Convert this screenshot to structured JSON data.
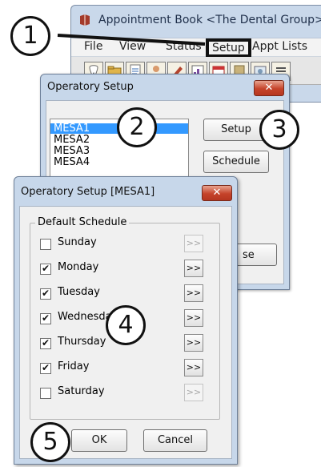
{
  "main_window": {
    "title": "Appointment Book <The Dental Group>",
    "menu": [
      "File",
      "View",
      "Status",
      "Setup",
      "Appt Lists"
    ],
    "toolbar_icons": [
      "tooth-icon",
      "folder-icon",
      "note-icon",
      "person-icon",
      "pencil-icon",
      "chart-icon",
      "calendar-icon",
      "book-icon",
      "photo-icon",
      "list-icon"
    ]
  },
  "operatory_setup": {
    "title": "Operatory Setup",
    "close_glyph": "✕",
    "operatories": [
      "MESA1",
      "MESA2",
      "MESA3",
      "MESA4"
    ],
    "setup_button": "Setup",
    "schedule_button": "Schedule",
    "close_partial_label": "se"
  },
  "mesa_dialog": {
    "title": "Operatory Setup [MESA1]",
    "close_glyph": "✕",
    "group_label": "Default Schedule",
    "days": [
      {
        "label": "Sunday",
        "checked": false,
        "enabled": false
      },
      {
        "label": "Monday",
        "checked": true,
        "enabled": true
      },
      {
        "label": "Tuesday",
        "checked": true,
        "enabled": true
      },
      {
        "label": "Wednesday",
        "checked": true,
        "enabled": true
      },
      {
        "label": "Thursday",
        "checked": true,
        "enabled": true
      },
      {
        "label": "Friday",
        "checked": true,
        "enabled": true
      },
      {
        "label": "Saturday",
        "checked": false,
        "enabled": false
      }
    ],
    "arrow_label": ">>",
    "ok_button": "OK",
    "cancel_button": "Cancel"
  },
  "callouts": [
    "1",
    "2",
    "3",
    "4",
    "5"
  ],
  "colors": {
    "selection": "#3399ff",
    "title_bar": "#c7d7ea",
    "close_button": "#c5432a",
    "highlight_border": "#111111"
  }
}
